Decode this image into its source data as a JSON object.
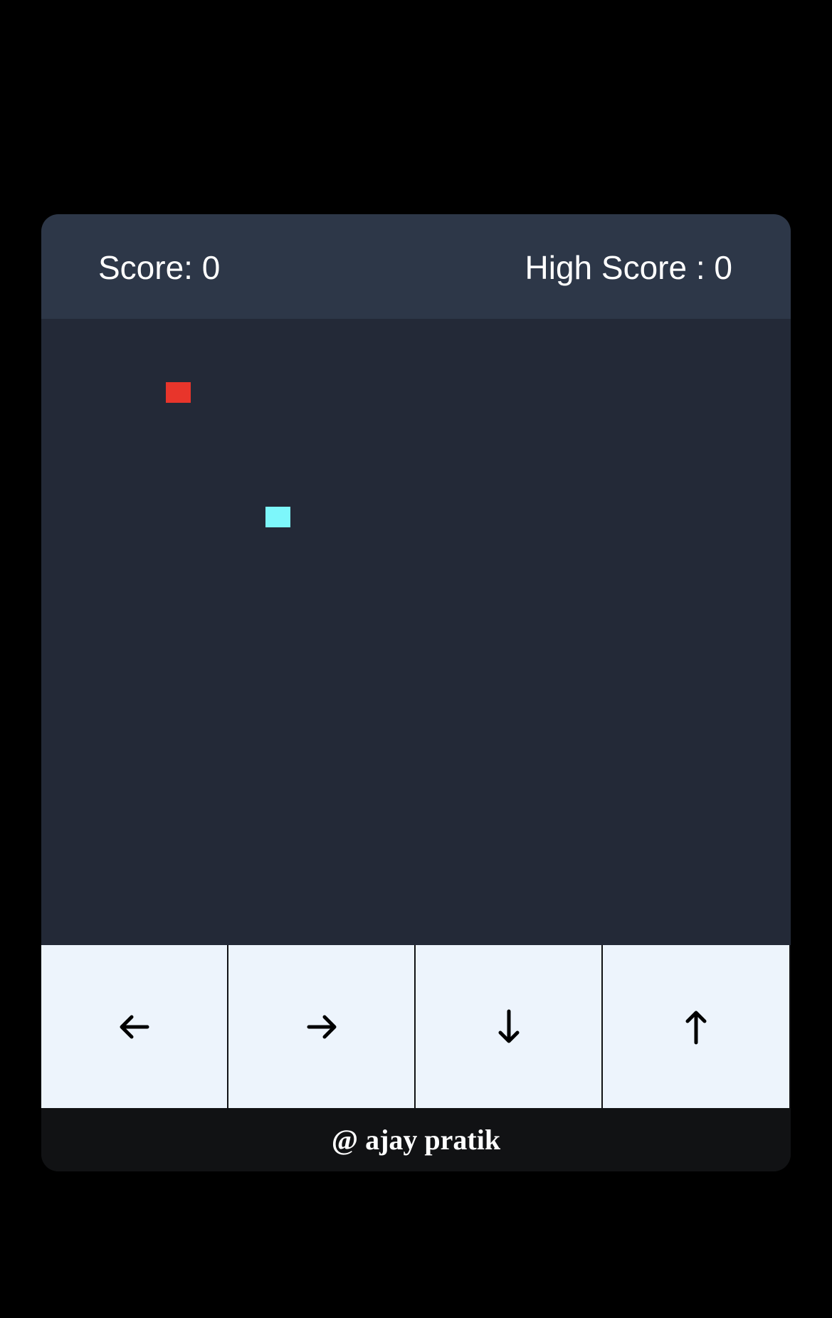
{
  "header": {
    "score_label": "Score: 0",
    "high_score_label": "High Score : 0"
  },
  "board": {
    "food_color": "#e8352b",
    "snake_color": "#7df7fb",
    "background": "#232937"
  },
  "controls": [
    {
      "direction": "left",
      "icon": "arrow-left-icon"
    },
    {
      "direction": "right",
      "icon": "arrow-right-icon"
    },
    {
      "direction": "down",
      "icon": "arrow-down-icon"
    },
    {
      "direction": "up",
      "icon": "arrow-up-icon"
    }
  ],
  "footer": {
    "credit": "@ ajay pratik"
  }
}
